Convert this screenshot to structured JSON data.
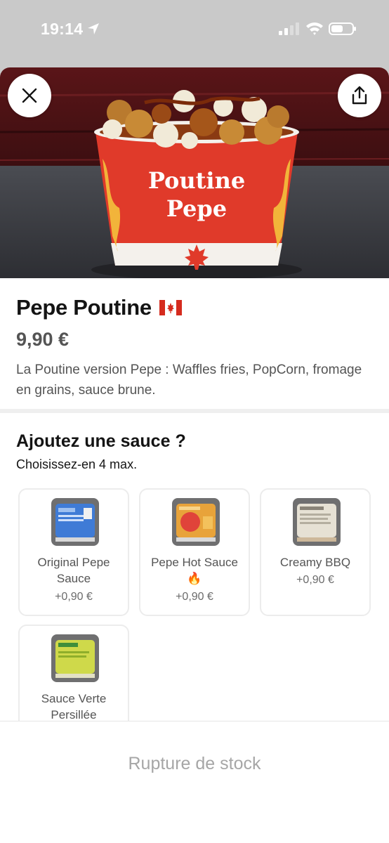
{
  "status_bar": {
    "time": "19:14",
    "icons": [
      "location-arrow-icon",
      "cellular-signal-icon",
      "wifi-icon",
      "battery-icon"
    ]
  },
  "header": {
    "close_icon": "close-icon",
    "share_icon": "share-icon"
  },
  "hero": {
    "cup_text_line1": "Poutine",
    "cup_text_line2": "Pepe"
  },
  "product": {
    "title": "Pepe Poutine",
    "flag_icon": "canada-flag-icon",
    "price": "9,90 €",
    "description": "La Poutine version Pepe : Waffles fries, PopCorn, fromage en grains, sauce brune."
  },
  "sauce_section": {
    "title": "Ajoutez une sauce ?",
    "subtitle": "Choisissez-en 4 max.",
    "options": [
      {
        "name": "Original Pepe Sauce",
        "price": "+0,90 €",
        "color": "#3f7bd6"
      },
      {
        "name": "Pepe Hot Sauce 🔥",
        "price": "+0,90 €",
        "color": "#e8a33a"
      },
      {
        "name": "Creamy BBQ",
        "price": "+0,90 €",
        "color": "#d8d2c2"
      },
      {
        "name": "Sauce Verte Persillée",
        "price": "",
        "color": "#cfd94a"
      }
    ]
  },
  "footer": {
    "button_label": "Rupture de stock"
  },
  "colors": {
    "backdrop": "#c9c9c9",
    "text_primary": "#141414",
    "text_secondary": "#545454",
    "disabled": "#a6a6a6",
    "cup_red": "#e03a2a"
  }
}
